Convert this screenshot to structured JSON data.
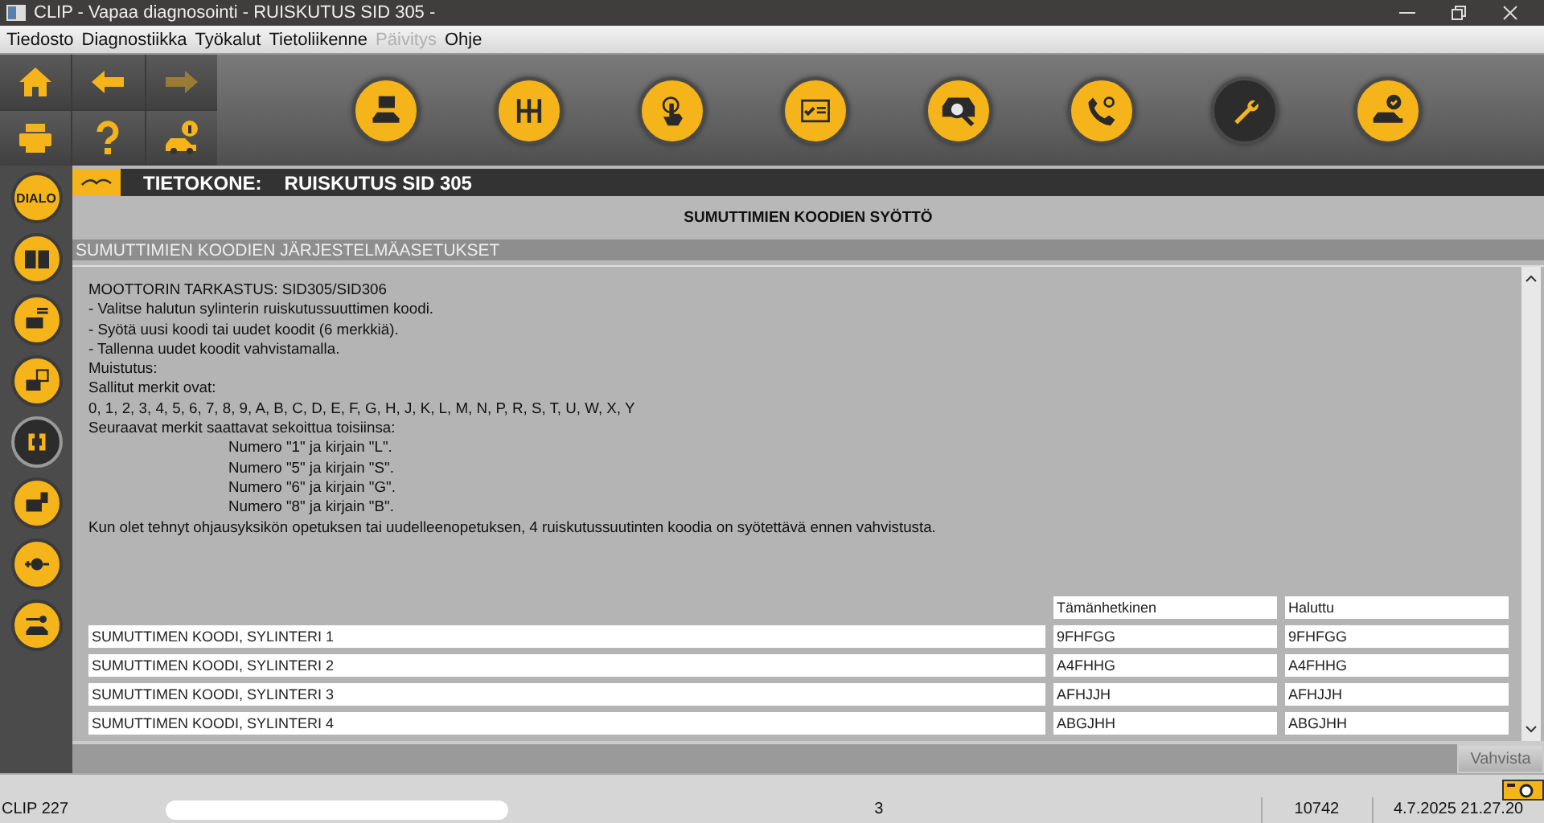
{
  "window": {
    "title": "CLIP - Vapaa diagnosointi - RUISKUTUS SID 305 -"
  },
  "menu": [
    {
      "label": "Tiedosto",
      "disabled": false
    },
    {
      "label": "Diagnostiikka",
      "disabled": false
    },
    {
      "label": "Työkalut",
      "disabled": false
    },
    {
      "label": "Tietoliikenne",
      "disabled": false
    },
    {
      "label": "Päivitys",
      "disabled": true
    },
    {
      "label": "Ohje",
      "disabled": false
    }
  ],
  "nav_buttons": [
    {
      "disabled": false
    },
    {
      "disabled": false
    },
    {
      "disabled": true
    },
    {
      "disabled": false
    },
    {
      "disabled": false
    },
    {
      "disabled": false
    }
  ],
  "toolbar": [
    {
      "selected": false
    },
    {
      "selected": false
    },
    {
      "selected": false
    },
    {
      "selected": false
    },
    {
      "selected": false
    },
    {
      "selected": false
    },
    {
      "selected": true
    },
    {
      "selected": false
    }
  ],
  "sidebar": [
    {
      "label": "DIALO",
      "selected": false
    },
    {
      "selected": false
    },
    {
      "selected": false
    },
    {
      "selected": false
    },
    {
      "selected": true
    },
    {
      "selected": false
    },
    {
      "selected": false
    },
    {
      "selected": false
    }
  ],
  "header": {
    "label": "TIETOKONE:",
    "title": "RUISKUTUS SID 305"
  },
  "page_title": "SUMUTTIMIEN KOODIEN SYÖTTÖ",
  "section_title": "SUMUTTIMIEN KOODIEN JÄRJESTELMÄASETUKSET",
  "instructions": [
    {
      "text": "MOOTTORIN TARKASTUS: SID305/SID306",
      "indent": false
    },
    {
      "text": "- Valitse halutun sylinterin ruiskutussuuttimen koodi.",
      "indent": false
    },
    {
      "text": "- Syötä uusi koodi tai uudet koodit (6 merkkiä).",
      "indent": false
    },
    {
      "text": "- Tallenna uudet koodit vahvistamalla.",
      "indent": false
    },
    {
      "text": "Muistutus:",
      "indent": false
    },
    {
      "text": "Sallitut merkit ovat:",
      "indent": false
    },
    {
      "text": "0, 1, 2, 3, 4, 5, 6, 7, 8, 9, A, B, C, D, E, F, G, H, J, K, L, M, N, P, R, S, T, U, W, X, Y",
      "indent": false
    },
    {
      "text": "Seuraavat merkit saattavat sekoittua toisiinsa:",
      "indent": false
    },
    {
      "text": "Numero \"1\" ja kirjain \"L\".",
      "indent": true
    },
    {
      "text": "Numero \"5\" ja kirjain \"S\".",
      "indent": true
    },
    {
      "text": "Numero \"6\" ja kirjain \"G\".",
      "indent": true
    },
    {
      "text": "Numero \"8\" ja kirjain \"B\".",
      "indent": true
    },
    {
      "text": "Kun olet tehnyt ohjausyksikön opetuksen tai uudelleenopetuksen, 4 ruiskutussuutinten koodia on syötettävä ennen vahvistusta.",
      "indent": false
    }
  ],
  "table": {
    "columns": [
      "Tämänhetkinen",
      "Haluttu"
    ],
    "rows": [
      {
        "label": "SUMUTTIMEN KOODI,  SYLINTERI 1",
        "current": "9FHFGG",
        "desired": "9FHFGG"
      },
      {
        "label": "SUMUTTIMEN KOODI,  SYLINTERI 2",
        "current": "A4FHHG",
        "desired": "A4FHHG"
      },
      {
        "label": "SUMUTTIMEN KOODI,  SYLINTERI 3",
        "current": "AFHJJH",
        "desired": "AFHJJH"
      },
      {
        "label": "SUMUTTIMEN KOODI,  SYLINTERI 4",
        "current": "ABGJHH",
        "desired": "ABGJHH"
      }
    ]
  },
  "confirm_button": {
    "label": "Vahvista",
    "disabled": true
  },
  "status_bar": {
    "version": "CLIP 227",
    "page": "3",
    "code": "10742",
    "datetime": "4.7.2025 21.27.20"
  }
}
